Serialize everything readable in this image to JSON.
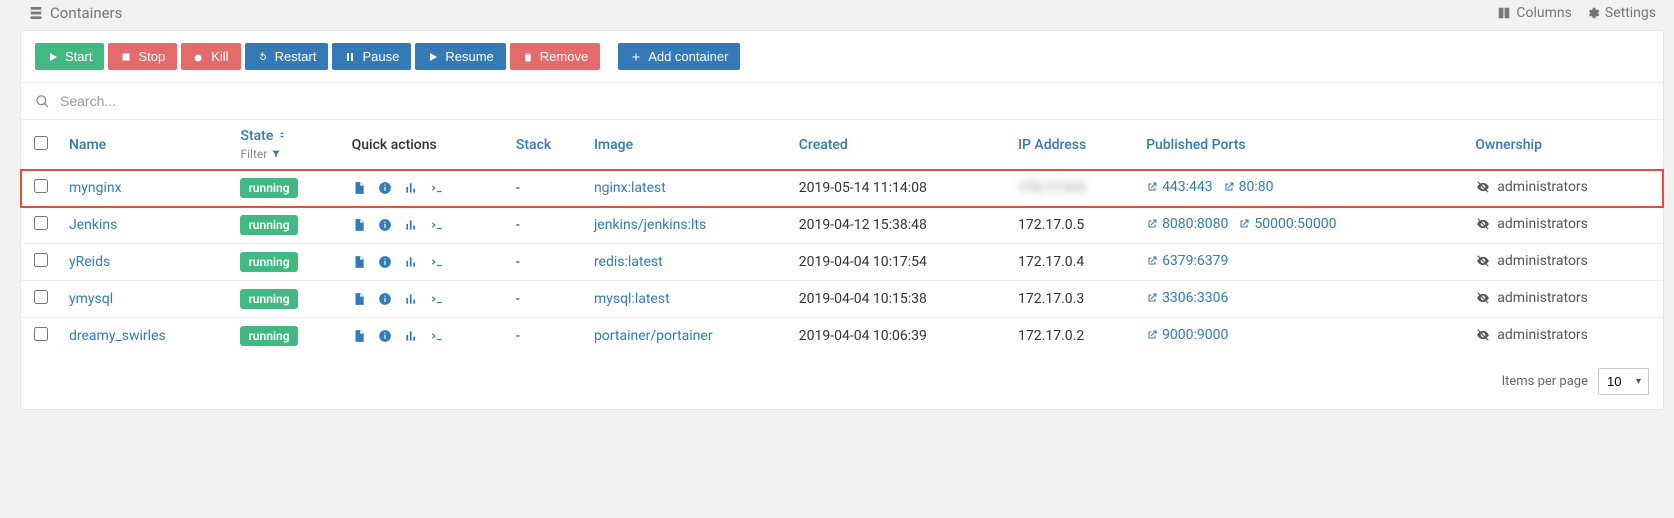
{
  "header": {
    "title": "Containers",
    "columns_label": "Columns",
    "settings_label": "Settings"
  },
  "toolbar": {
    "start": "Start",
    "stop": "Stop",
    "kill": "Kill",
    "restart": "Restart",
    "pause": "Pause",
    "resume": "Resume",
    "remove": "Remove",
    "add": "Add container"
  },
  "search": {
    "placeholder": "Search..."
  },
  "columns": {
    "name": "Name",
    "state": "State",
    "filter": "Filter",
    "quick": "Quick actions",
    "stack": "Stack",
    "image": "Image",
    "created": "Created",
    "ip": "IP Address",
    "ports": "Published Ports",
    "ownership": "Ownership"
  },
  "rows": [
    {
      "name": "mynginx",
      "state": "running",
      "stack": "-",
      "image": "nginx:latest",
      "created": "2019-05-14 11:14:08",
      "ip": "",
      "ip_blur": true,
      "ports": [
        "443:443",
        "80:80"
      ],
      "ownership": "administrators",
      "highlight": true
    },
    {
      "name": "Jenkins",
      "state": "running",
      "stack": "-",
      "image": "jenkins/jenkins:lts",
      "created": "2019-04-12 15:38:48",
      "ip": "172.17.0.5",
      "ports": [
        "8080:8080",
        "50000:50000"
      ],
      "ownership": "administrators"
    },
    {
      "name": "yReids",
      "state": "running",
      "stack": "-",
      "image": "redis:latest",
      "created": "2019-04-04 10:17:54",
      "ip": "172.17.0.4",
      "ports": [
        "6379:6379"
      ],
      "ownership": "administrators"
    },
    {
      "name": "ymysql",
      "state": "running",
      "stack": "-",
      "image": "mysql:latest",
      "created": "2019-04-04 10:15:38",
      "ip": "172.17.0.3",
      "ports": [
        "3306:3306"
      ],
      "ownership": "administrators"
    },
    {
      "name": "dreamy_swirles",
      "state": "running",
      "stack": "-",
      "image": "portainer/portainer",
      "created": "2019-04-04 10:06:39",
      "ip": "172.17.0.2",
      "ports": [
        "9000:9000"
      ],
      "ownership": "administrators"
    }
  ],
  "footer": {
    "items_per_page": "Items per page",
    "value": "10"
  }
}
